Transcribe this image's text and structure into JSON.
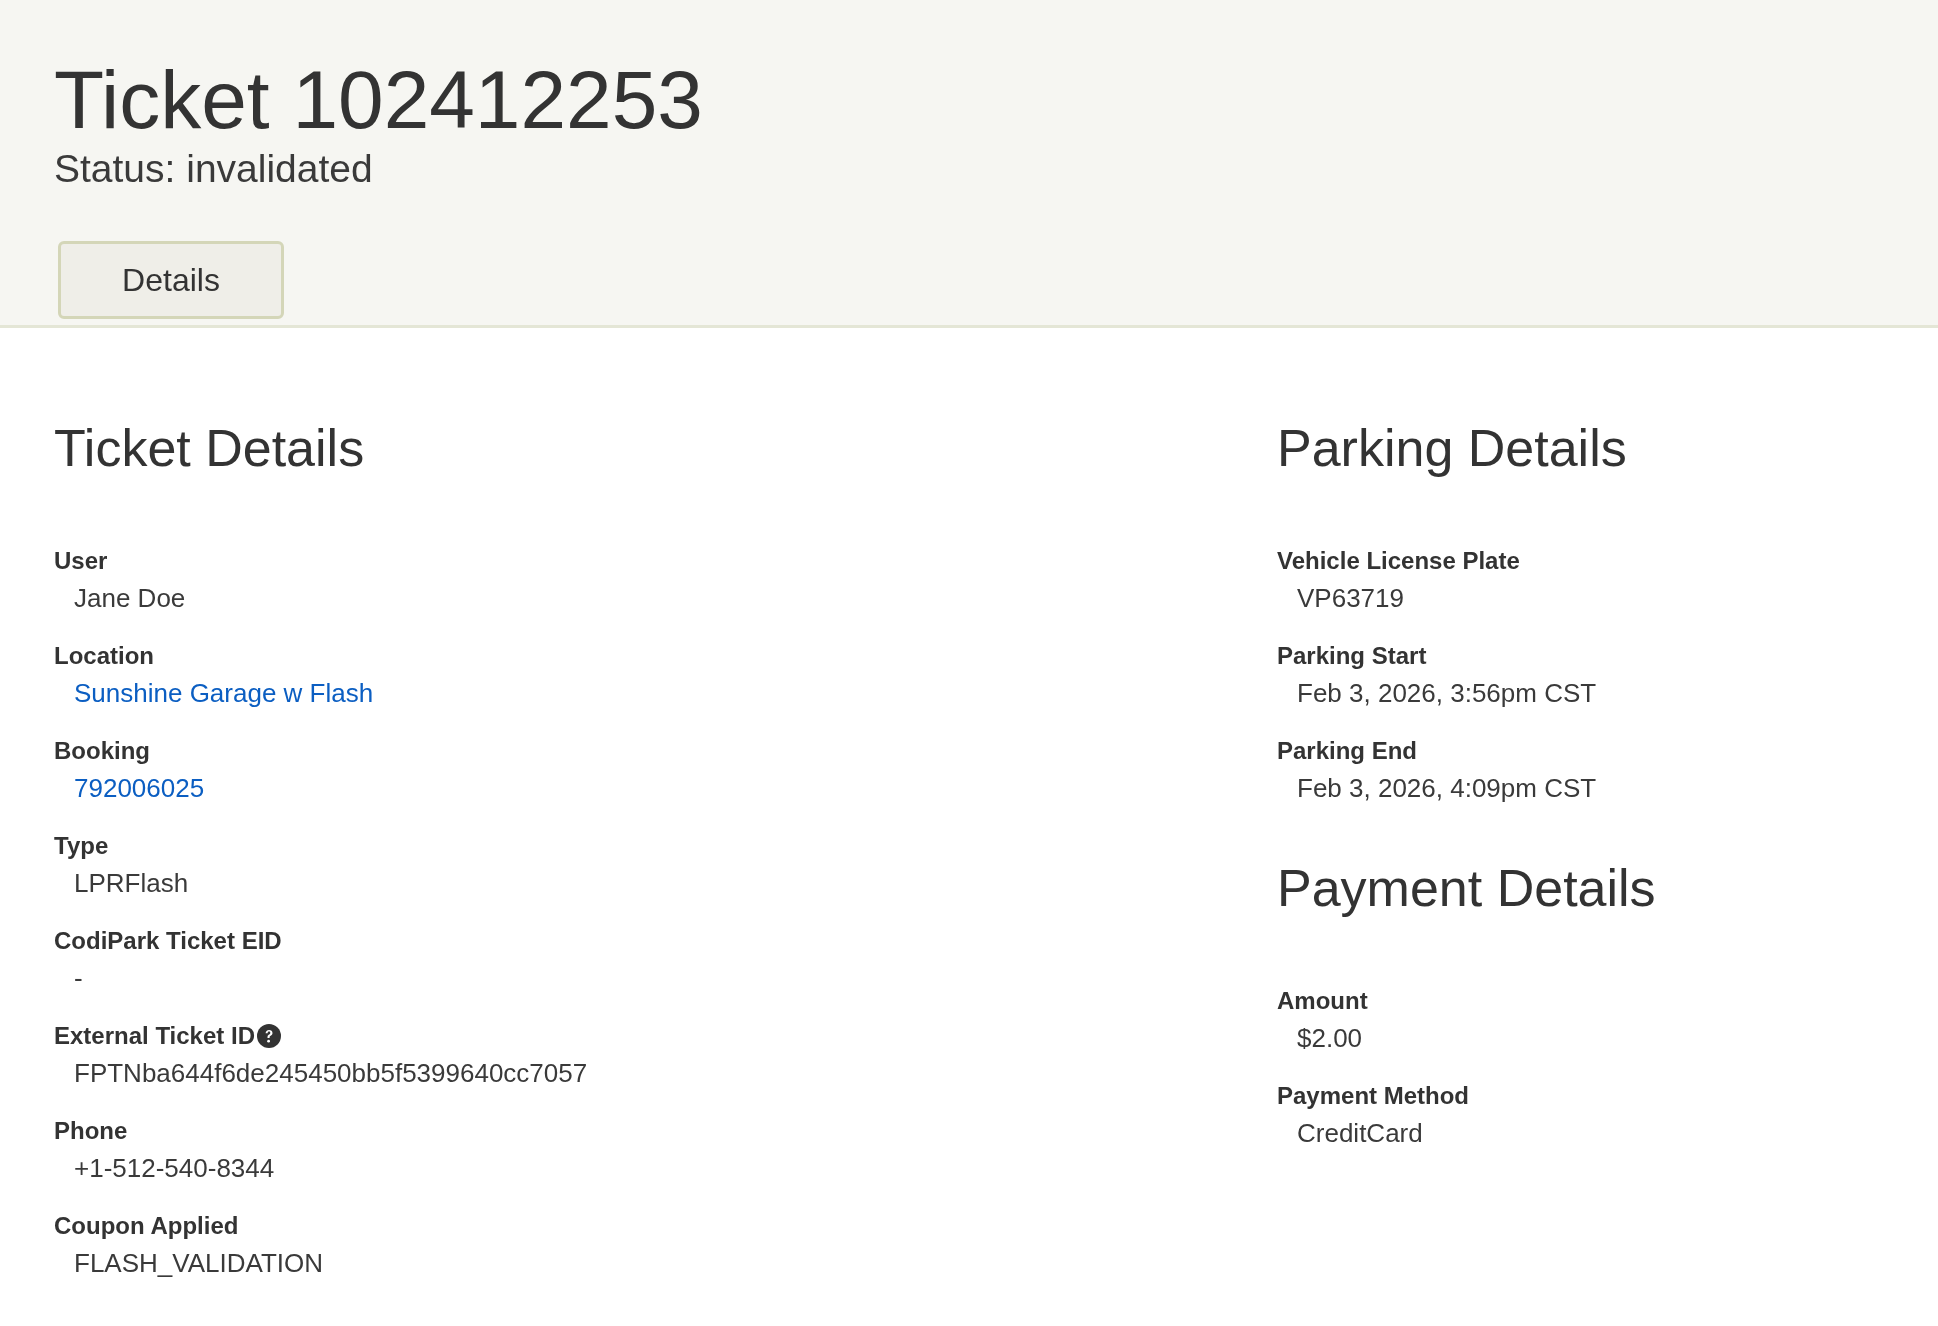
{
  "header": {
    "title": "Ticket 102412253",
    "status": "Status: invalidated"
  },
  "tabs": [
    {
      "label": "Details",
      "selected": true
    }
  ],
  "columns": [
    {
      "sections": [
        {
          "heading": "Ticket Details",
          "fields": [
            {
              "label": "User",
              "value": "Jane Doe",
              "kind": "text",
              "help": false
            },
            {
              "label": "Location",
              "value": "Sunshine Garage w Flash",
              "kind": "link",
              "help": false
            },
            {
              "label": "Booking",
              "value": "792006025",
              "kind": "link",
              "help": false
            },
            {
              "label": "Type",
              "value": "LPRFlash",
              "kind": "text",
              "help": false
            },
            {
              "label": "CodiPark Ticket EID",
              "value": "-",
              "kind": "text",
              "help": false
            },
            {
              "label": "External Ticket ID",
              "value": "FPTNba644f6de245450bb5f5399640cc7057",
              "kind": "text",
              "help": true
            },
            {
              "label": "Phone",
              "value": "+1-512-540-8344",
              "kind": "text",
              "help": false
            },
            {
              "label": "Coupon Applied",
              "value": "FLASH_VALIDATION",
              "kind": "text",
              "help": false
            }
          ]
        }
      ]
    },
    {
      "sections": [
        {
          "heading": "Parking Details",
          "fields": [
            {
              "label": "Vehicle License Plate",
              "value": "VP63719",
              "kind": "text",
              "help": false
            },
            {
              "label": "Parking Start",
              "value": "Feb 3, 2026, 3:56pm CST",
              "kind": "text",
              "help": false
            },
            {
              "label": "Parking End",
              "value": "Feb 3, 2026, 4:09pm CST",
              "kind": "text",
              "help": false
            }
          ]
        },
        {
          "heading": "Payment Details",
          "fields": [
            {
              "label": "Amount",
              "value": "$2.00",
              "kind": "text",
              "help": false
            },
            {
              "label": "Payment Method",
              "value": "CreditCard",
              "kind": "text",
              "help": false
            }
          ]
        }
      ]
    }
  ]
}
